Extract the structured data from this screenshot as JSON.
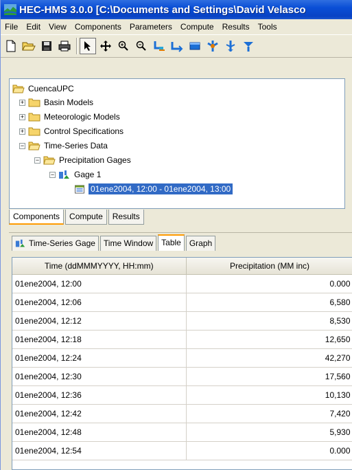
{
  "window": {
    "title": "HEC-HMS 3.0.0 [C:\\Documents and Settings\\David Velasco",
    "colors": {
      "title_bar": "#0a4ed6",
      "selection": "#316ac5",
      "tab_accent": "#ff9a00"
    }
  },
  "menu": [
    "File",
    "Edit",
    "View",
    "Components",
    "Parameters",
    "Compute",
    "Results",
    "Tools"
  ],
  "toolbar": {
    "buttons": [
      "new-icon",
      "open-icon",
      "save-icon",
      "print-icon",
      "arrow-pointer-icon",
      "move-icon",
      "zoom-in-icon",
      "zoom-out-icon",
      "subbasin-icon",
      "reach-icon",
      "reservoir-icon",
      "junction-icon",
      "diversion-icon",
      "sink-icon"
    ]
  },
  "tree": {
    "root": "CuencaUPC",
    "items": [
      {
        "label": "Basin Models",
        "expander": "+"
      },
      {
        "label": "Meteorologic Models",
        "expander": "+"
      },
      {
        "label": "Control Specifications",
        "expander": "+"
      },
      {
        "label": "Time-Series Data",
        "expander": "−"
      }
    ],
    "precipitation": {
      "label": "Precipitation Gages",
      "expander": "−"
    },
    "gage": {
      "label": "Gage 1",
      "expander": "−"
    },
    "window_item": "01ene2004, 12:00 - 01ene2004, 13:00"
  },
  "bottom_tabs": [
    "Components",
    "Compute",
    "Results"
  ],
  "editor_tabs": [
    "Time-Series Gage",
    "Time Window",
    "Table",
    "Graph"
  ],
  "table": {
    "headers": [
      "Time (ddMMMYYYY, HH:mm)",
      "Precipitation (MM inc)"
    ],
    "rows": [
      [
        "01ene2004, 12:00",
        "0.000"
      ],
      [
        "01ene2004, 12:06",
        "6,580"
      ],
      [
        "01ene2004, 12:12",
        "8,530"
      ],
      [
        "01ene2004, 12:18",
        "12,650"
      ],
      [
        "01ene2004, 12:24",
        "42,270"
      ],
      [
        "01ene2004, 12:30",
        "17,560"
      ],
      [
        "01ene2004, 12:36",
        "10,130"
      ],
      [
        "01ene2004, 12:42",
        "7,420"
      ],
      [
        "01ene2004, 12:48",
        "5,930"
      ],
      [
        "01ene2004, 12:54",
        "0.000"
      ]
    ]
  }
}
